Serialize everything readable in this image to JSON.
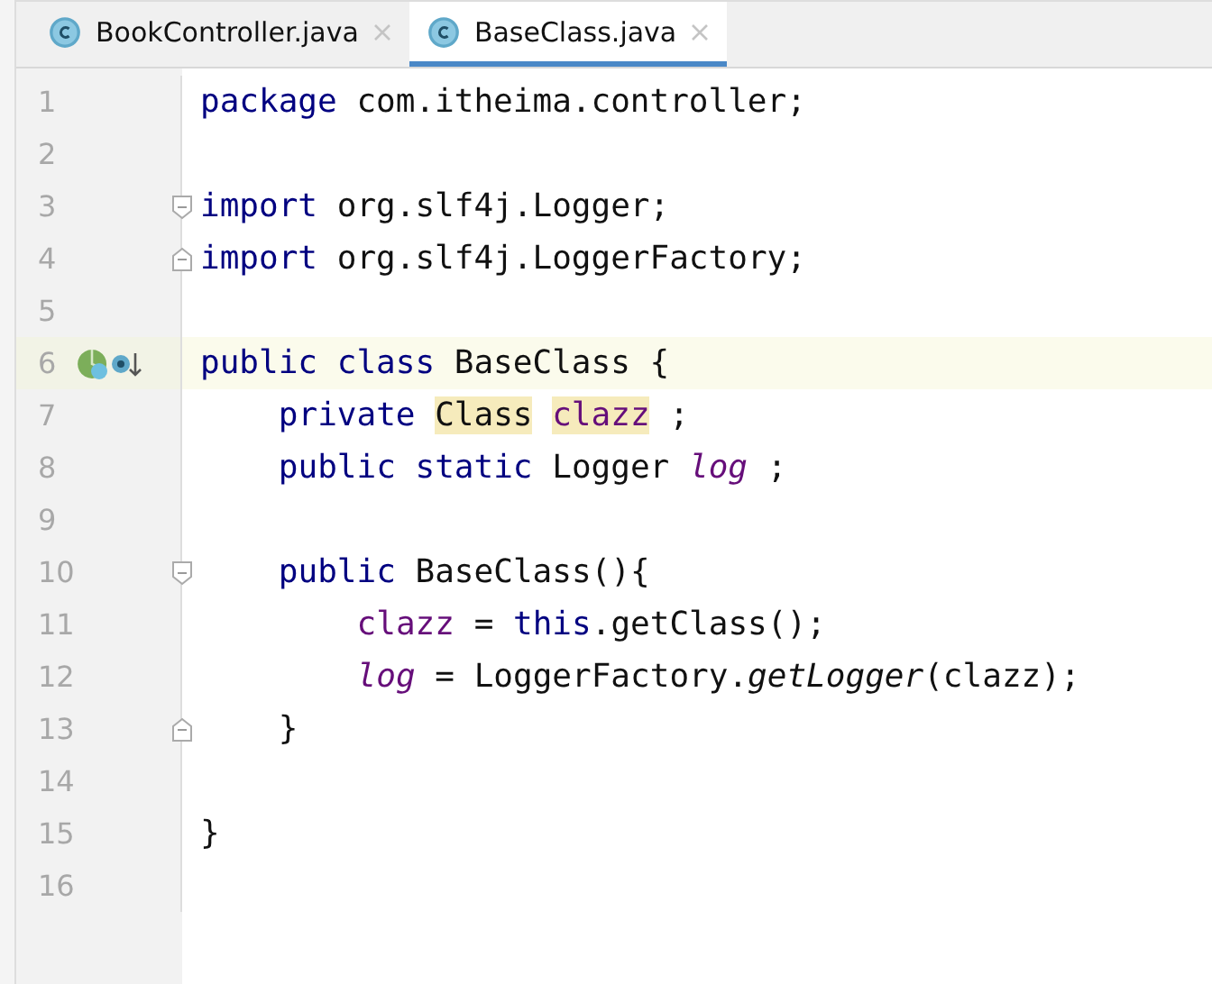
{
  "tabs": [
    {
      "label": "BookController.java",
      "selected": false
    },
    {
      "label": "BaseClass.java",
      "selected": true
    }
  ],
  "lines": [
    {
      "number": "1",
      "tokens": [
        {
          "text": "package",
          "kind": "keyword"
        },
        {
          "text": " com.itheima.controller;",
          "kind": "plain"
        }
      ]
    },
    {
      "number": "2"
    },
    {
      "number": "3",
      "fold_start": true,
      "tokens": [
        {
          "text": "import",
          "kind": "keyword"
        },
        {
          "text": " org.slf4j.Logger;",
          "kind": "plain"
        }
      ]
    },
    {
      "number": "4",
      "fold_end": true,
      "tokens": [
        {
          "text": "import",
          "kind": "keyword"
        },
        {
          "text": " org.slf4j.LoggerFactory;",
          "kind": "plain"
        }
      ]
    },
    {
      "number": "5"
    },
    {
      "number": "6",
      "current": true,
      "gutter_icons": true,
      "tokens": [
        {
          "text": "public",
          "kind": "keyword"
        },
        {
          "text": "class",
          "kind": "keyword",
          "space_before": true
        },
        {
          "text": " BaseClass {",
          "kind": "plain"
        }
      ],
      "children": [
        {
          "number": "7",
          "tokens": [
            {
              "text": "private",
              "kind": "keyword"
            },
            {
              "text": "Class",
              "kind": "highlight",
              "space_before": true
            },
            {
              "text": "clazz",
              "kind": "highlight-field",
              "space_before": true
            },
            {
              "text": " ;",
              "kind": "plain"
            }
          ]
        },
        {
          "number": "8",
          "tokens": [
            {
              "text": "public static",
              "kind": "keyword"
            },
            {
              "text": " Logger ",
              "kind": "plain"
            },
            {
              "text": "log",
              "kind": "static-field"
            },
            {
              "text": " ;",
              "kind": "plain"
            }
          ]
        },
        {
          "number": "9"
        },
        {
          "number": "10",
          "fold_start": true,
          "tokens": [
            {
              "text": "public",
              "kind": "keyword"
            },
            {
              "text": " BaseClass(){",
              "kind": "plain"
            }
          ],
          "children": [
            {
              "number": "11",
              "tokens": [
                {
                  "text": "clazz",
                  "kind": "field"
                },
                {
                  "text": " = ",
                  "kind": "plain"
                },
                {
                  "text": "this",
                  "kind": "keyword"
                },
                {
                  "text": ".getClass();",
                  "kind": "plain"
                }
              ]
            },
            {
              "number": "12",
              "tokens": [
                {
                  "text": "log",
                  "kind": "static-field"
                },
                {
                  "text": " = LoggerFactory.",
                  "kind": "plain"
                },
                {
                  "text": "getLogger",
                  "kind": "static-call"
                },
                {
                  "text": "(clazz);",
                  "kind": "plain"
                }
              ]
            }
          ]
        },
        {
          "number": "13",
          "fold_end": true,
          "tokens": [
            {
              "text": "}",
              "kind": "plain"
            }
          ]
        }
      ]
    },
    {
      "number": "14"
    },
    {
      "number": "15",
      "tokens": [
        {
          "text": "}",
          "kind": "plain"
        }
      ]
    },
    {
      "number": "16"
    }
  ]
}
